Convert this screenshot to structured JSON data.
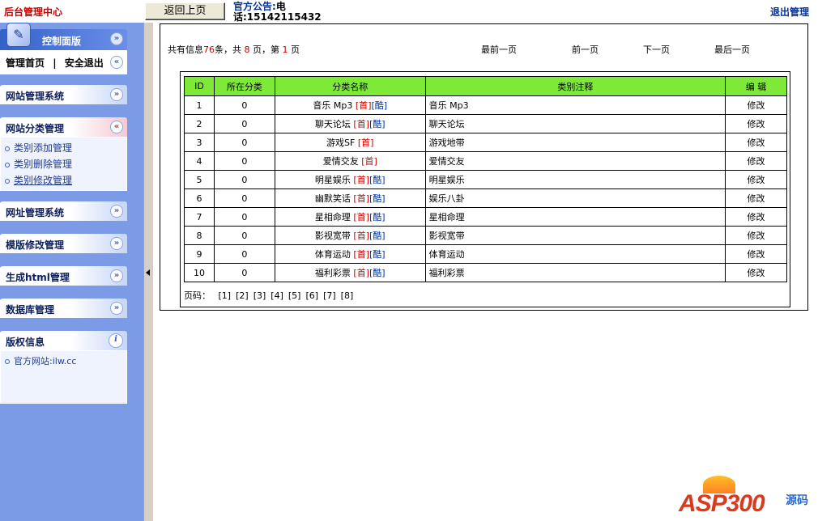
{
  "header": {
    "brand": "后台管理中心",
    "back_button": "返回上页",
    "notice_label": "官方公告:",
    "notice_text": "电",
    "notice_phone": "话:15142115432",
    "logout": "退出管理"
  },
  "sidebar": {
    "control": {
      "title": "控制面版",
      "home_link": "管理首页",
      "separator": "|",
      "safe_exit": "安全退出"
    },
    "sections": [
      {
        "title": "网站管理系统"
      },
      {
        "title": "网站分类管理",
        "items": [
          "类别添加管理",
          "类别删除管理",
          "类别修改管理"
        ]
      },
      {
        "title": "网址管理系统"
      },
      {
        "title": "模版修改管理"
      },
      {
        "title": "生成html管理"
      },
      {
        "title": "数据库管理"
      },
      {
        "title": "版权信息",
        "items": [
          "官方网站:ilw.cc"
        ]
      }
    ]
  },
  "summary": {
    "prefix": "共有信息",
    "total": "76",
    "mid1": "条，共",
    "pages": "8",
    "mid2": "页，第",
    "current": "1",
    "suffix": "页"
  },
  "nav": {
    "first": "最前一页",
    "prev": "前一页",
    "next": "下一页",
    "last": "最后一页"
  },
  "table": {
    "headers": [
      "ID",
      "所在分类",
      "分类名称",
      "类别注释",
      "编 辑"
    ],
    "rows": [
      {
        "id": "1",
        "cat": "0",
        "name": "音乐 Mp3",
        "tags": [
          "首",
          "酷"
        ],
        "note": "音乐 Mp3",
        "edit": "修改"
      },
      {
        "id": "2",
        "cat": "0",
        "name": "聊天论坛",
        "tags": [
          "首",
          "酷"
        ],
        "note": "聊天论坛",
        "edit": "修改"
      },
      {
        "id": "3",
        "cat": "0",
        "name": "游戏SF",
        "tags": [
          "首"
        ],
        "note": "游戏地带",
        "edit": "修改"
      },
      {
        "id": "4",
        "cat": "0",
        "name": "爱情交友",
        "tags": [
          "首"
        ],
        "note": "爱情交友",
        "edit": "修改"
      },
      {
        "id": "5",
        "cat": "0",
        "name": "明星娱乐",
        "tags": [
          "首",
          "酷"
        ],
        "note": "明星娱乐",
        "edit": "修改"
      },
      {
        "id": "6",
        "cat": "0",
        "name": "幽默笑话",
        "tags": [
          "首",
          "酷"
        ],
        "note": "娱乐八卦",
        "edit": "修改"
      },
      {
        "id": "7",
        "cat": "0",
        "name": "星相命理",
        "tags": [
          "首",
          "酷"
        ],
        "note": "星相命理",
        "edit": "修改"
      },
      {
        "id": "8",
        "cat": "0",
        "name": "影视宽带",
        "tags": [
          "首",
          "酷"
        ],
        "note": "影视宽带",
        "edit": "修改"
      },
      {
        "id": "9",
        "cat": "0",
        "name": "体育运动",
        "tags": [
          "首",
          "酷"
        ],
        "note": "体育运动",
        "edit": "修改"
      },
      {
        "id": "10",
        "cat": "0",
        "name": "福利彩票",
        "tags": [
          "首",
          "酷"
        ],
        "note": "福利彩票",
        "edit": "修改"
      }
    ]
  },
  "pagination": {
    "label": "页码：",
    "pages": [
      "[1]",
      "[2]",
      "[3]",
      "[4]",
      "[5]",
      "[6]",
      "[7]",
      "[8]"
    ]
  },
  "watermark": {
    "text": "ASP300",
    "sub": "源码"
  },
  "icons": {
    "control_logo": "control-panel-icon",
    "chevrons": "chevron-double-icon",
    "info": "info-icon",
    "collapse": "collapse-arrow-icon"
  },
  "colors": {
    "sidebar_bg": "#7b9be6",
    "header_row_bg": "#7dea38",
    "brand_red": "#cc0000",
    "link_blue": "#003399"
  }
}
